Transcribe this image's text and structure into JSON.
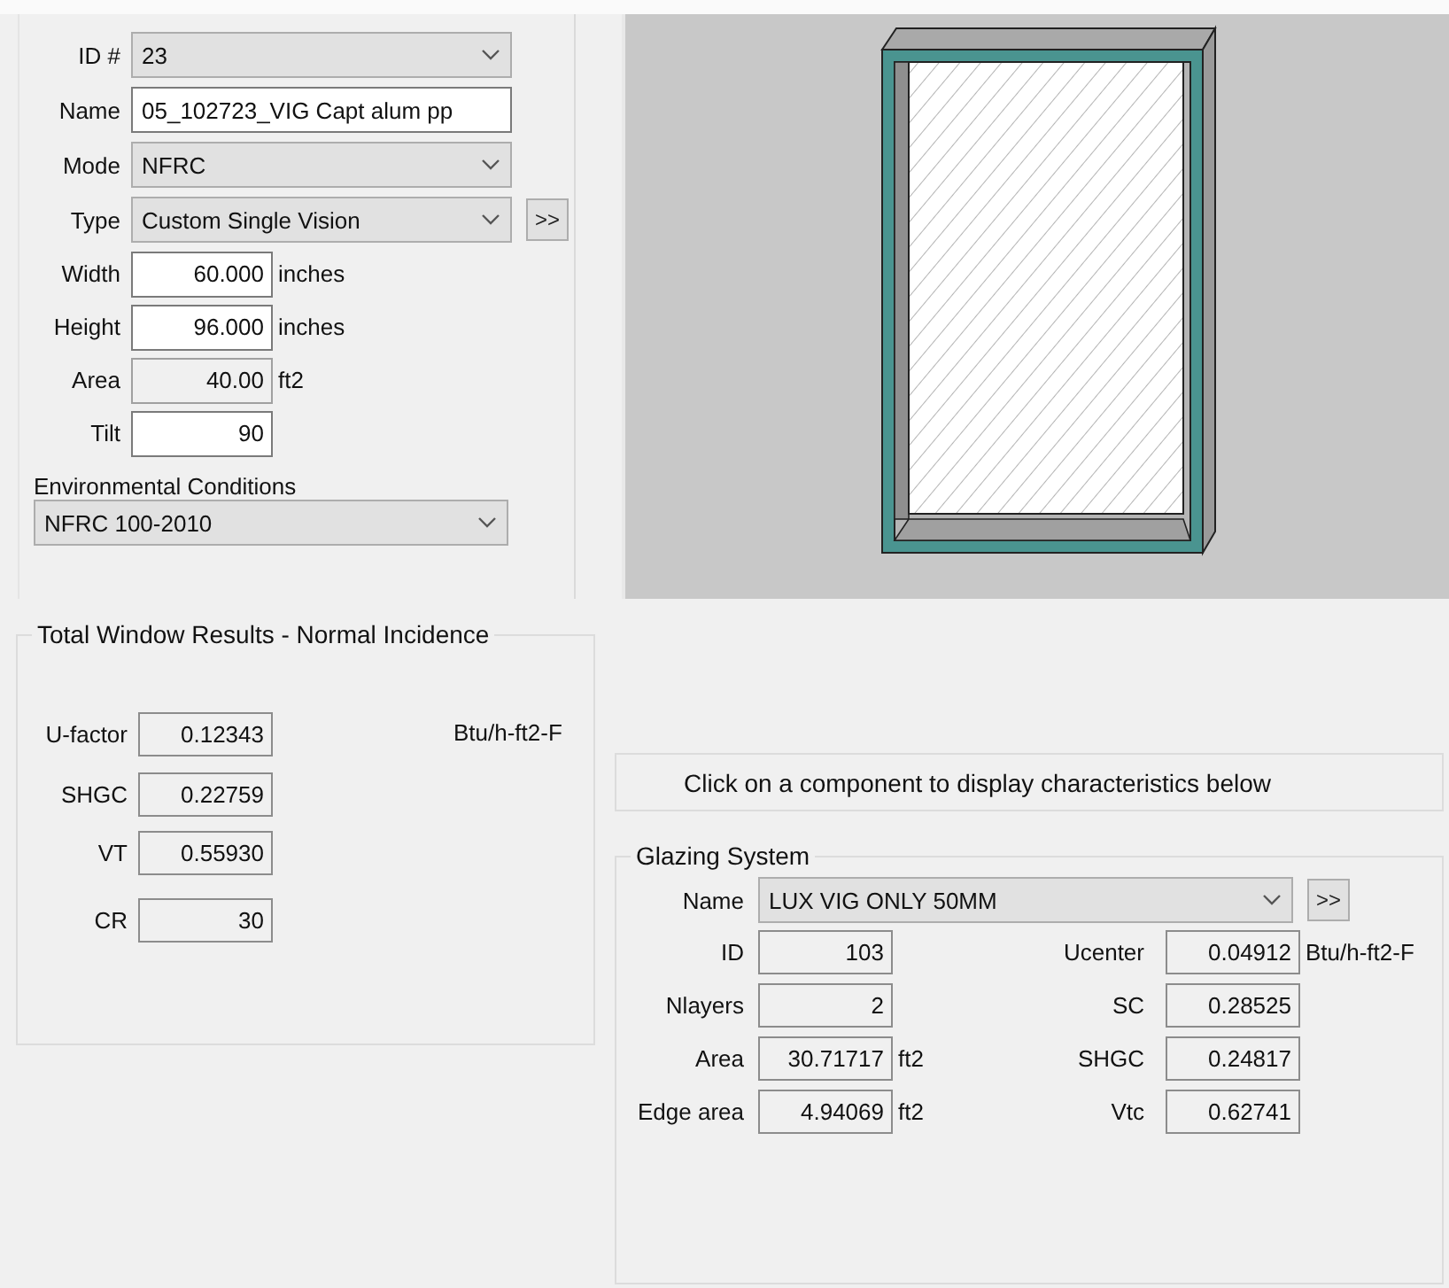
{
  "window_properties": {
    "fields": [
      {
        "label": "ID #",
        "kind": "dropdown",
        "value": "23"
      },
      {
        "label": "Name",
        "kind": "text",
        "value": "05_102723_VIG Capt alum pp"
      },
      {
        "label": "Mode",
        "kind": "dropdown",
        "value": "NFRC"
      },
      {
        "label": "Type",
        "kind": "dropdown",
        "value": "Custom Single Vision",
        "button": ">>"
      },
      {
        "label": "Width",
        "kind": "number",
        "value": "60.000",
        "unit": "inches"
      },
      {
        "label": "Height",
        "kind": "number",
        "value": "96.000",
        "unit": "inches"
      },
      {
        "label": "Area",
        "kind": "readonly",
        "value": "40.00",
        "unit": "ft2"
      },
      {
        "label": "Tilt",
        "kind": "number",
        "value": "90"
      }
    ],
    "environmental_conditions": {
      "label": "Environmental Conditions",
      "value": "NFRC 100-2010"
    }
  },
  "total_window_results": {
    "title": "Total Window Results - Normal Incidence",
    "unit": "Btu/h-ft2-F",
    "rows": [
      {
        "label": "U-factor",
        "value": "0.12343"
      },
      {
        "label": "SHGC",
        "value": "0.22759"
      },
      {
        "label": "VT",
        "value": "0.55930"
      },
      {
        "label": "CR",
        "value": "30"
      }
    ]
  },
  "hint": "Click on a component to display characteristics below",
  "glazing_system": {
    "title": "Glazing System",
    "name_label": "Name",
    "name_value": "LUX VIG ONLY 50MM",
    "button": ">>",
    "right_unit": "Btu/h-ft2-F",
    "left": [
      {
        "label": "ID",
        "value": "103"
      },
      {
        "label": "Nlayers",
        "value": "2"
      },
      {
        "label": "Area",
        "value": "30.71717",
        "unit": "ft2"
      },
      {
        "label": "Edge area",
        "value": "4.94069",
        "unit": "ft2"
      }
    ],
    "right": [
      {
        "label": "Ucenter",
        "value": "0.04912"
      },
      {
        "label": "SC",
        "value": "0.28525"
      },
      {
        "label": "SHGC",
        "value": "0.24817"
      },
      {
        "label": "Vtc",
        "value": "0.62741"
      }
    ]
  }
}
